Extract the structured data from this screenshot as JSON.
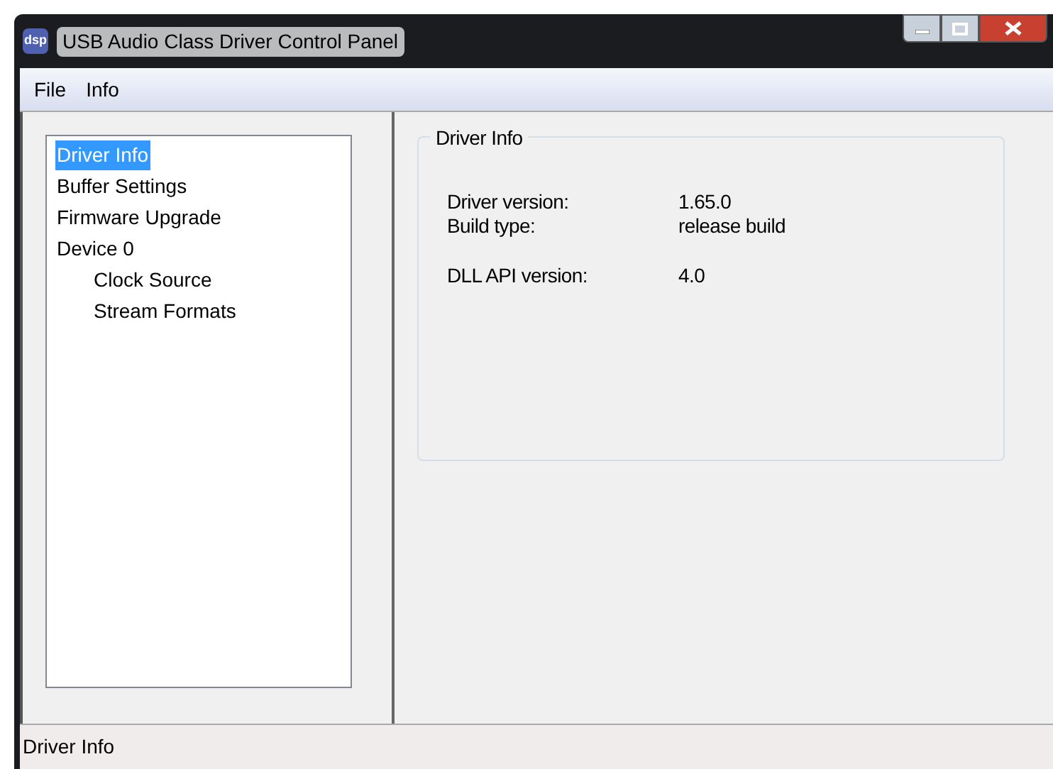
{
  "window": {
    "title": "USB Audio Class Driver Control Panel",
    "logo": "dsp"
  },
  "menu": [
    "File",
    "Info"
  ],
  "tree": [
    {
      "label": "Driver Info",
      "selected": true
    },
    {
      "label": "Buffer Settings",
      "selected": false
    },
    {
      "label": "Firmware Upgrade",
      "selected": false
    },
    {
      "label": "Device 0",
      "selected": false,
      "children": [
        {
          "label": "Clock Source",
          "selected": false
        },
        {
          "label": "Stream Formats",
          "selected": false
        }
      ]
    }
  ],
  "group": {
    "title": "Driver Info",
    "sections": [
      [
        {
          "label": "Driver version:",
          "value": "1.65.0"
        },
        {
          "label": "Build type:",
          "value": "release build"
        }
      ],
      [
        {
          "label": "DLL API version:",
          "value": "4.0"
        }
      ]
    ]
  },
  "status_bar": "Driver Info"
}
